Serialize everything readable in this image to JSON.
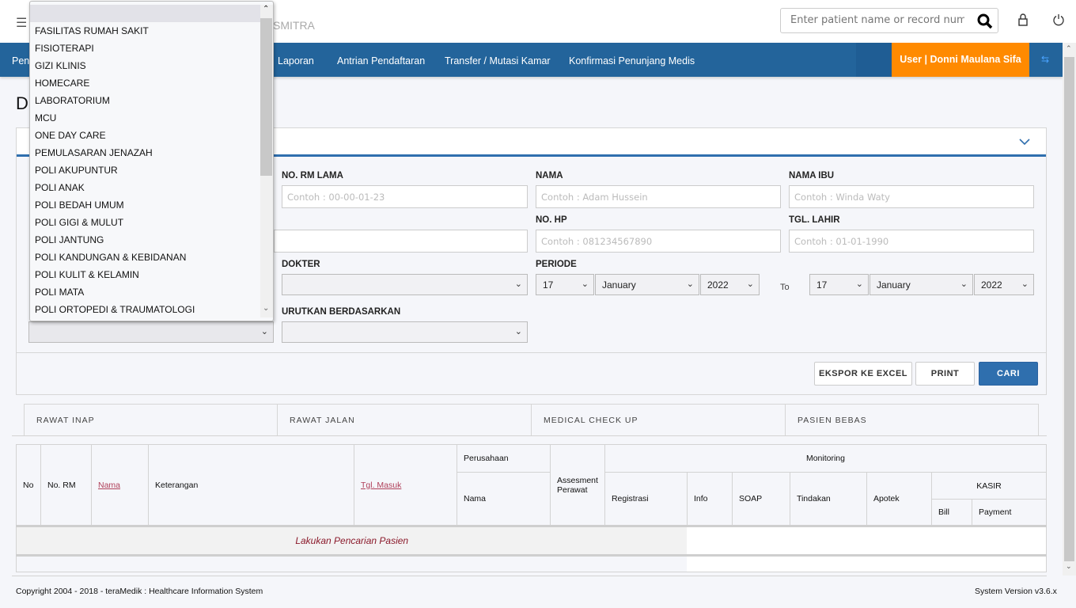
{
  "header": {
    "brand_partial": "SMITRA",
    "search_placeholder": "Enter patient name or record number"
  },
  "nav": {
    "items": [
      "Pen",
      "Laporan",
      "Antrian Pendaftaran",
      "Transfer / Mutasi Kamar",
      "Konfirmasi Penunjang Medis"
    ],
    "user": "User | Donni Maulana Sifa"
  },
  "colors": {
    "nav": "#23649b",
    "user": "#ff8a00",
    "primary": "#2f6fae"
  },
  "page": {
    "title_partial": "D"
  },
  "form": {
    "no_rm_lama": {
      "label": "NO. RM LAMA",
      "placeholder": "Contoh : 00-00-01-23"
    },
    "nama": {
      "label": "NAMA",
      "placeholder": "Contoh : Adam Hussein"
    },
    "nama_ibu": {
      "label": "NAMA IBU",
      "placeholder": "Contoh : Winda Waty"
    },
    "no_hp": {
      "label": "NO. HP",
      "placeholder": "Contoh : 081234567890"
    },
    "tgl_lahir": {
      "label": "TGL. LAHIR",
      "placeholder": "Contoh : 01-01-1990"
    },
    "dokter": {
      "label": "DOKTER",
      "value": ""
    },
    "periode": {
      "label": "PERIODE",
      "from": {
        "day": "17",
        "month": "January",
        "year": "2022"
      },
      "to_label": "To",
      "to": {
        "day": "17",
        "month": "January",
        "year": "2022"
      }
    },
    "urutkan": {
      "label": "URUTKAN BERDASARKAN",
      "value": ""
    }
  },
  "buttons": {
    "excel": "EKSPOR KE EXCEL",
    "print": "PRINT",
    "cari": "CARI"
  },
  "tabs": [
    "RAWAT INAP",
    "RAWAT JALAN",
    "MEDICAL CHECK UP",
    "PASIEN BEBAS"
  ],
  "table": {
    "no": "No",
    "no_rm": "No. RM",
    "nama": "Nama",
    "keterangan": "Keterangan",
    "tgl_masuk": "Tgl. Masuk",
    "perusahaan": "Perusahaan",
    "perusahaan_nama": "Nama",
    "assesment": "Assesment Perawat",
    "monitoring": "Monitoring",
    "registrasi": "Registrasi",
    "info": "Info",
    "soap": "SOAP",
    "tindakan": "Tindakan",
    "apotek": "Apotek",
    "kasir": "KASIR",
    "bill": "Bill",
    "payment": "Payment",
    "empty": "Lakukan Pencarian Pasien"
  },
  "dropdown": {
    "options": [
      "",
      "FASILITAS RUMAH SAKIT",
      "FISIOTERAPI",
      "GIZI KLINIS",
      "HOMECARE",
      "LABORATORIUM",
      "MCU",
      "ONE DAY CARE",
      "PEMULASARAN JENAZAH",
      "POLI AKUPUNTUR",
      "POLI ANAK",
      "POLI BEDAH UMUM",
      "POLI GIGI & MULUT",
      "POLI JANTUNG",
      "POLI KANDUNGAN & KEBIDANAN",
      "POLI KULIT & KELAMIN",
      "POLI MATA",
      "POLI ORTOPEDI & TRAUMATOLOGI"
    ]
  },
  "footer": {
    "copyright": "Copyright 2004 - 2018 - teraMedik : Healthcare Information System",
    "version": "System Version v3.6.x"
  }
}
